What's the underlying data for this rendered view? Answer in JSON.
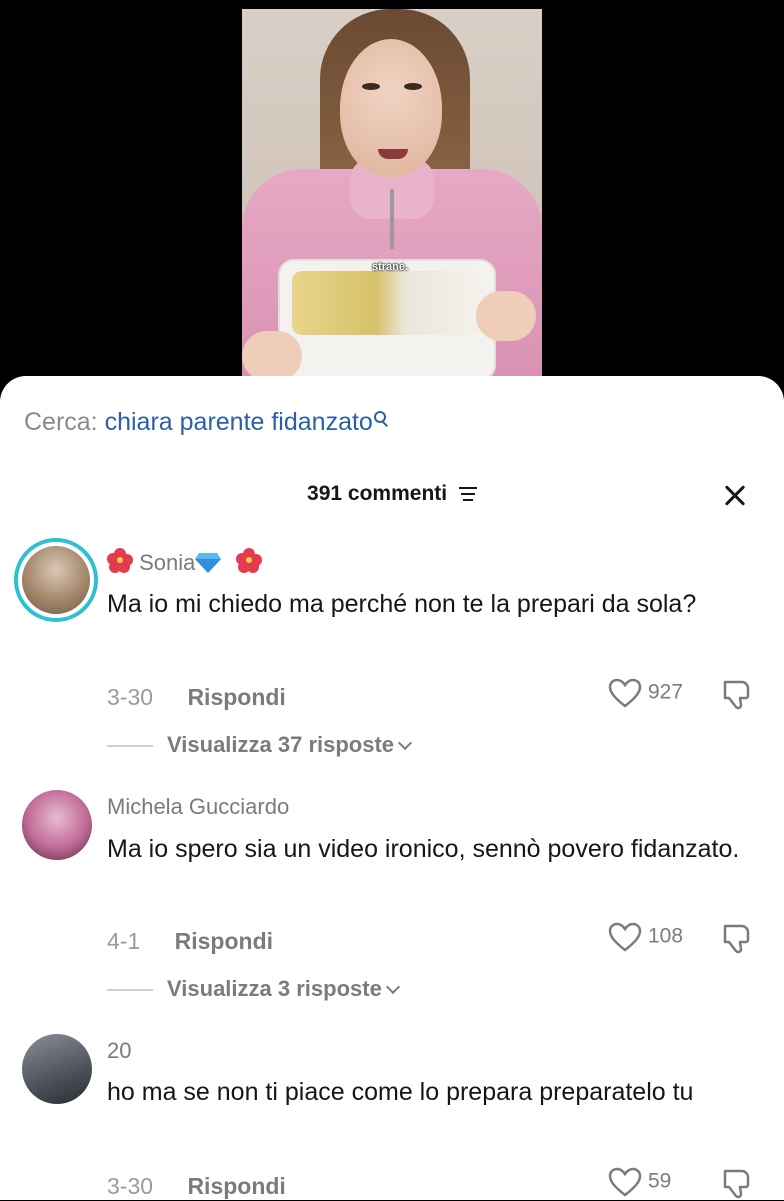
{
  "video": {
    "caption": "strane."
  },
  "search": {
    "prefix": "Cerca:",
    "term": "chiara parente fidanzato"
  },
  "header": {
    "count": "391 commenti"
  },
  "comments": [
    {
      "username": "Sonia",
      "text": "Ma io mi chiedo ma perché non te la prepari da sola?",
      "date": "3-30",
      "reply_label": "Rispondi",
      "likes": "927",
      "view_replies": "Visualizza 37 risposte"
    },
    {
      "username": "Michela Gucciardo",
      "text": "Ma io spero sia un video ironico, sennò povero fidanzato.",
      "date": "4-1",
      "reply_label": "Rispondi",
      "likes": "108",
      "view_replies": "Visualizza 3 risposte"
    },
    {
      "username": "20",
      "text": "ho ma se non ti piace come lo prepara preparatelo tu",
      "date": "3-30",
      "reply_label": "Rispondi",
      "likes": "59"
    }
  ]
}
